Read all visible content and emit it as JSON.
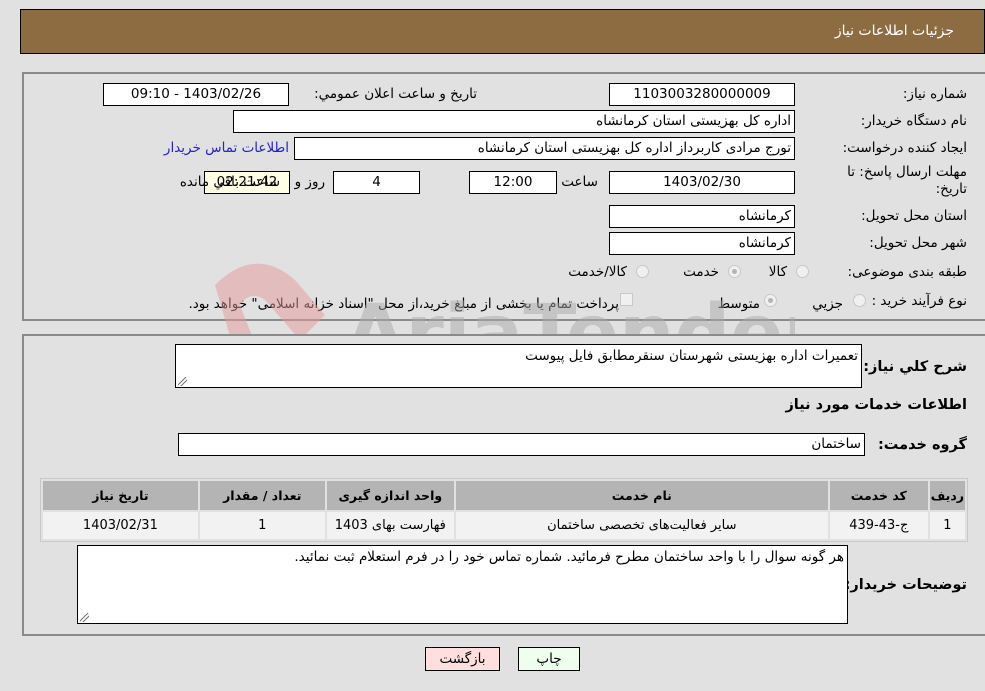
{
  "header": {
    "title": "جزئیات اطلاعات نیاز"
  },
  "form": {
    "need_number_label": "شماره نیاز:",
    "need_number": "1103003280000009",
    "announce_label": "تاريخ و ساعت اعلان عمومي:",
    "announce_value": "1403/02/26 - 09:10",
    "buyer_org_label": "نام دستگاه خريدار:",
    "buyer_org": "اداره کل بهزیستی استان کرمانشاه",
    "creator_label": "ايجاد کننده درخواست:",
    "creator": "تورج مرادی کاربرداز  اداره کل بهزیستی استان کرمانشاه",
    "buyer_contact_link": "اطلاعات تماس خريدار",
    "deadline_label": "مهلت ارسال پاسخ: تا تاریخ:",
    "deadline_date": "1403/02/30",
    "time_label": "ساعت",
    "deadline_time": "12:00",
    "days_value": "4",
    "days_label": "روز و",
    "remaining_time": "02:21:42",
    "remaining_label": "ساعت باقي مانده",
    "province_label": "استان محل تحویل:",
    "province": "کرمانشاه",
    "city_label": "شهر محل تحویل:",
    "city": "کرمانشاه",
    "category_label": "طبقه بندی موضوعی:",
    "category_options": [
      {
        "label": "کالا",
        "selected": false
      },
      {
        "label": "خدمت",
        "selected": true
      },
      {
        "label": "کالا/خدمت",
        "selected": false
      }
    ],
    "process_label": "نوع فرآیند خرید :",
    "process_options": [
      {
        "label": "جزيي",
        "selected": false
      },
      {
        "label": "متوسط",
        "selected": true
      }
    ],
    "treasury_checkbox_label": "پرداخت تمام یا بخشی از مبلغ خرید،از محل \"اسناد خزانه اسلامی\" خواهد بود.",
    "treasury_checked": false
  },
  "details": {
    "description_label": "شرح کلي نياز:",
    "description": "تعمیرات اداره بهزیستی شهرستان سنقرمطابق فایل پیوست",
    "services_heading": "اطلاعات خدمات مورد نياز",
    "service_group_label": "گروه خدمت:",
    "service_group": "ساختمان",
    "table": {
      "headers": [
        "رديف",
        "کد خدمت",
        "نام خدمت",
        "واحد اندازه گیری",
        "تعداد / مقدار",
        "تاریخ نیاز"
      ],
      "rows": [
        [
          "1",
          "ج-43-439",
          "سایر فعالیت‌های تخصصی ساختمان",
          "فهارست بهای 1403",
          "1",
          "1403/02/31"
        ]
      ]
    },
    "buyer_notes_label": "توضيحات خريدار:",
    "buyer_notes": "هر گونه سوال را با واحد ساختمان مطرح فرمائید. شماره تماس خود را  در فرم استعلام ثبت نمائید."
  },
  "buttons": {
    "print": "چاپ",
    "back": "بازگشت"
  },
  "watermark": {
    "text": "AriaTender.neT"
  },
  "colors": {
    "header_bg": "#8d6c42",
    "print_bg": "#eeffee",
    "back_bg": "#ffdede",
    "link": "#2222cc"
  }
}
